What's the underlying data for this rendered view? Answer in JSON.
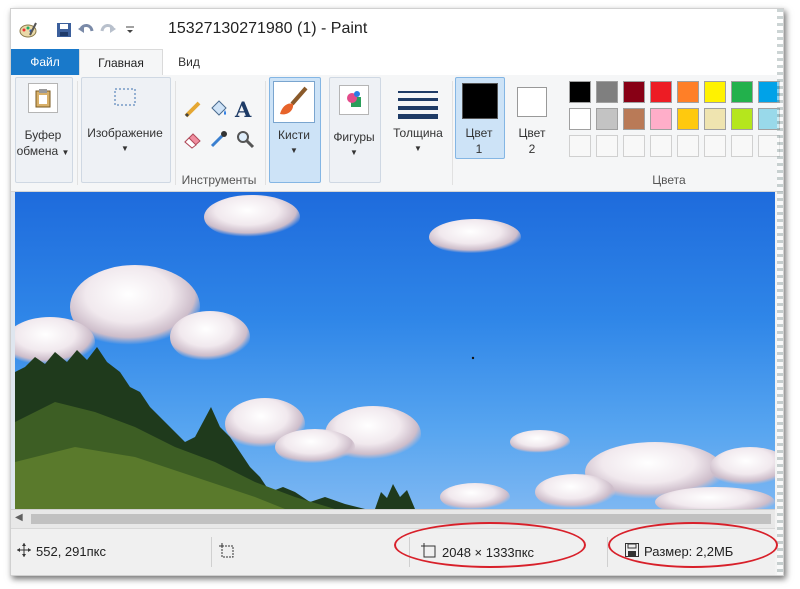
{
  "window": {
    "title": "15327130271980 (1) - Paint"
  },
  "tabs": {
    "file": "Файл",
    "home": "Главная",
    "view": "Вид"
  },
  "ribbon": {
    "clipboard": {
      "label_line1": "Буфер",
      "label_line2": "обмена"
    },
    "image": {
      "label": "Изображение"
    },
    "tools": {
      "group_label": "Инструменты"
    },
    "brushes": {
      "label": "Кисти"
    },
    "shapes": {
      "label": "Фигуры"
    },
    "size": {
      "label": "Толщина"
    },
    "color1": {
      "label_line1": "Цвет",
      "label_line2": "1",
      "color": "#000000"
    },
    "color2": {
      "label_line1": "Цвет",
      "label_line2": "2",
      "color": "#ffffff"
    },
    "colors": {
      "group_label": "Цвета",
      "row1": [
        "#000000",
        "#7f7f7f",
        "#880015",
        "#ed1c24",
        "#ff7f27",
        "#fff200",
        "#22b14c",
        "#00a2e8"
      ],
      "row2": [
        "#ffffff",
        "#c3c3c3",
        "#b97a57",
        "#ffaec9",
        "#ffc90e",
        "#efe4b0",
        "#b5e61d",
        "#99d9ea"
      ]
    }
  },
  "status": {
    "cursor_pos": "552, 291пкс",
    "image_size": "2048 × 1333пкс",
    "file_size": "Размер: 2,2МБ"
  },
  "icons": {
    "move": "move-icon",
    "selection": "selection-size-icon",
    "image_size": "image-size-icon",
    "disk": "disk-icon"
  },
  "annotation_color": "#d8202a"
}
